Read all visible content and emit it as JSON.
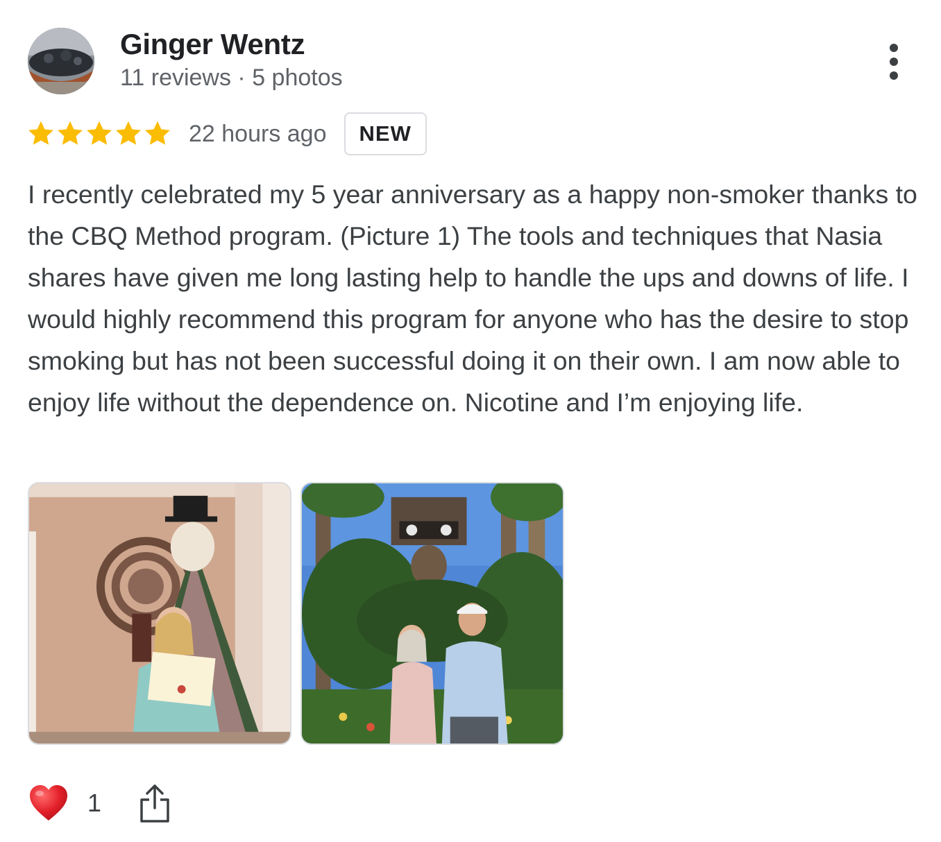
{
  "reviewer": {
    "name": "Ginger Wentz",
    "meta": "11 reviews · 5 photos"
  },
  "review": {
    "rating": 5,
    "rating_max": 5,
    "timestamp": "22 hours ago",
    "badge": "NEW",
    "text": "I recently celebrated my 5 year anniversary as a happy non-smoker thanks to the CBQ Method program. (Picture 1) The tools and techniques that Nasia shares have given me long lasting help to handle the ups and downs of life. I would highly recommend this program for anyone who has the desire to stop smoking but has not been successful doing it on their own. I am now able to enjoy life without the dependence on. Nicotine and I’m enjoying life."
  },
  "actions": {
    "like_count": "1",
    "like_icon": "heart-icon",
    "share_icon": "share-icon",
    "more_icon": "more-vert-icon"
  },
  "colors": {
    "star": "#fbbc04",
    "heart": "#e3202a",
    "name": "#202124",
    "meta": "#5f6368",
    "body_text": "#3c4043",
    "badge_border": "#dadce0"
  }
}
